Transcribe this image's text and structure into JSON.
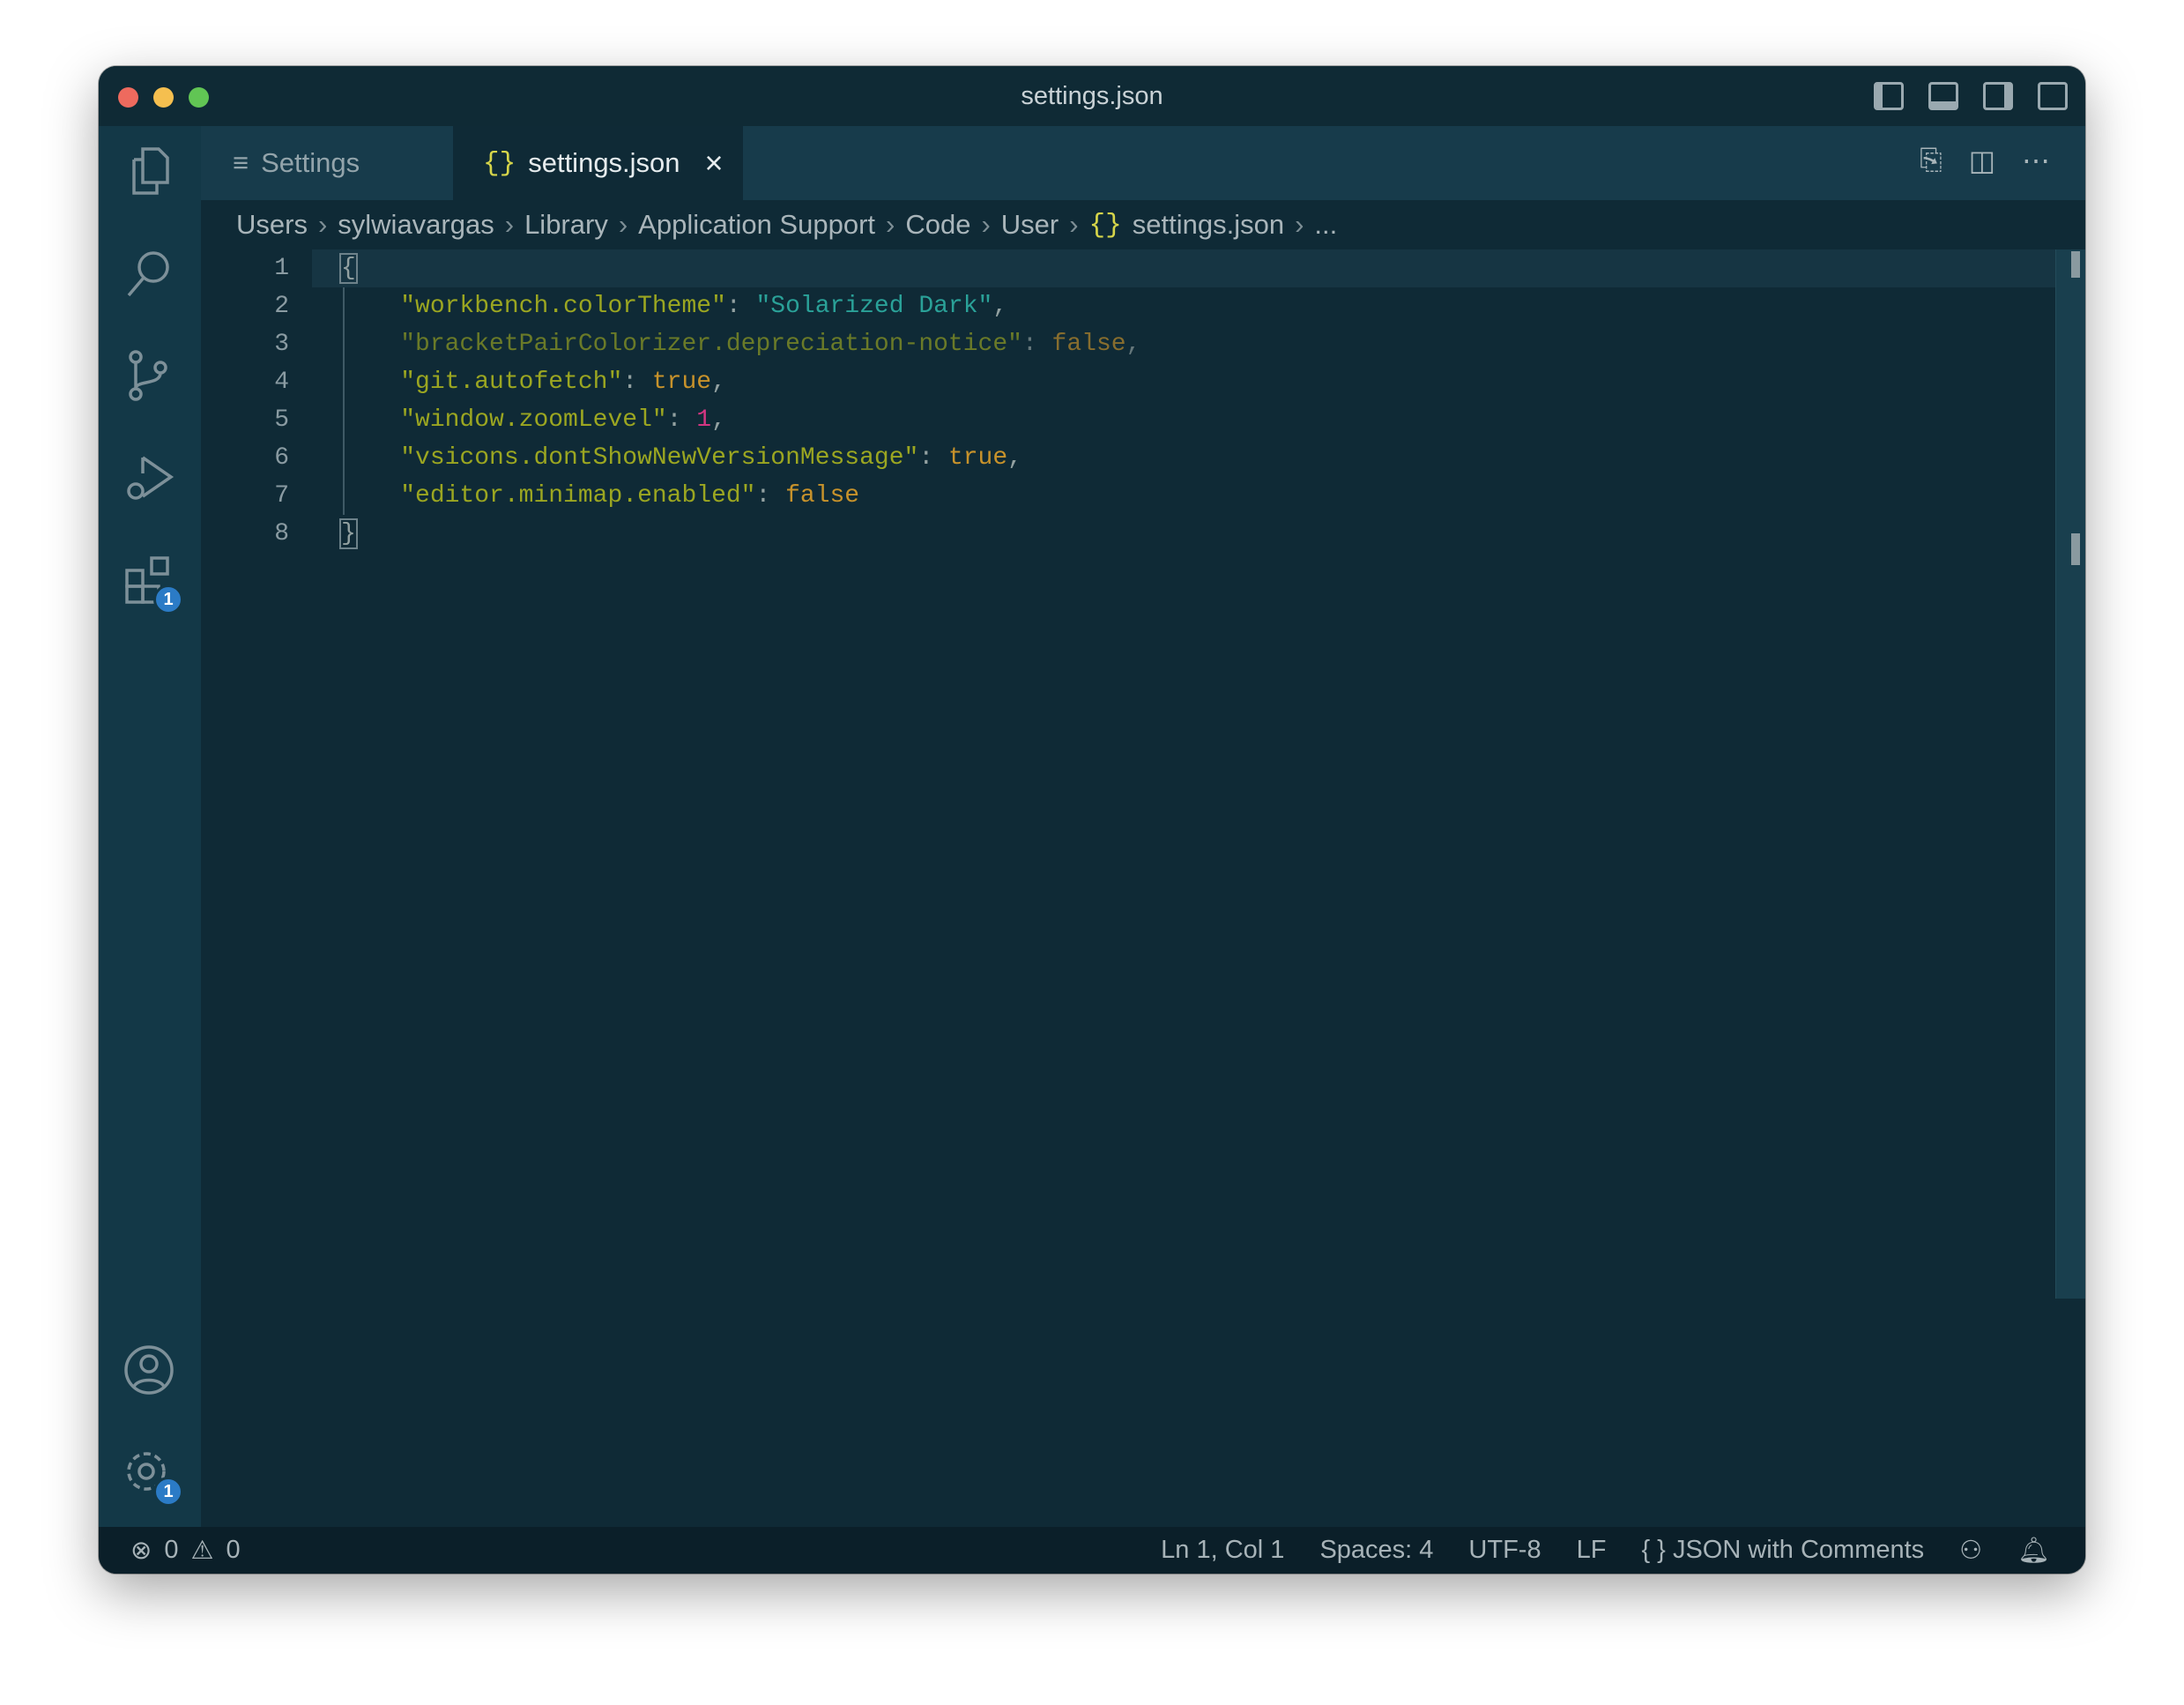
{
  "window": {
    "title": "settings.json"
  },
  "tabs": [
    {
      "label": "Settings",
      "icon": "menu-lines-icon"
    },
    {
      "label": "settings.json",
      "icon": "braces-icon",
      "close": "×"
    }
  ],
  "breadcrumb": [
    "Users",
    "sylwiavargas",
    "Library",
    "Application Support",
    "Code",
    "User",
    "settings.json",
    "..."
  ],
  "editor": {
    "lines": [
      {
        "n": "1"
      },
      {
        "n": "2"
      },
      {
        "n": "3"
      },
      {
        "n": "4"
      },
      {
        "n": "5"
      },
      {
        "n": "6"
      },
      {
        "n": "7"
      },
      {
        "n": "8"
      }
    ],
    "code": {
      "l1": "{",
      "l2k": "\"workbench.colorTheme\"",
      "l2v": "\"Solarized Dark\"",
      "l3k": "\"bracketPairColorizer.depreciation-notice\"",
      "l3v": "false",
      "l4k": "\"git.autofetch\"",
      "l4v": "true",
      "l5k": "\"window.zoomLevel\"",
      "l5v": "1",
      "l6k": "\"vsicons.dontShowNewVersionMessage\"",
      "l6v": "true",
      "l7k": "\"editor.minimap.enabled\"",
      "l7v": "false",
      "l8": "}"
    }
  },
  "activity": {
    "extensions_badge": "1",
    "settings_badge": "1"
  },
  "status": {
    "errors": "0",
    "warnings": "0",
    "position": "Ln 1, Col 1",
    "spaces": "Spaces: 4",
    "encoding": "UTF-8",
    "eol": "LF",
    "language": "JSON with Comments"
  }
}
